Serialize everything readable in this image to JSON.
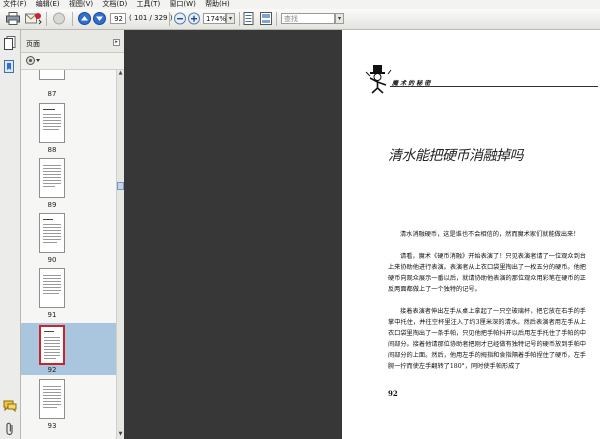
{
  "menu": [
    "文件(F)",
    "编辑(E)",
    "视图(V)",
    "文档(D)",
    "工具(T)",
    "窗口(W)",
    "帮助(H)"
  ],
  "toolbar": {
    "page_number": "92",
    "page_count": "( 101 / 329 )",
    "zoom": "174%",
    "search_placeholder": "查找"
  },
  "panel": {
    "title": "页面",
    "thumbnails": [
      {
        "label": "87"
      },
      {
        "label": "88"
      },
      {
        "label": "89"
      },
      {
        "label": "90"
      },
      {
        "label": "91"
      },
      {
        "label": "92",
        "selected": true
      },
      {
        "label": "93"
      }
    ]
  },
  "page": {
    "header": "魔 术 的 秘 密",
    "title": "清水能把硬币消融掉吗",
    "paragraphs": [
      "清水消融硬币，这是谁也不会相信的，然而魔术家们就能做出来！",
      "请看，魔术《硬币消融》开始表演了！只见表演者请了一位观众到台上来协助他进行表演。表演者从上衣口袋里掏出了一枚五分的硬币。他把硬币向观众展示一番以后，就请协助他表演的那位观众用彩笔在硬币的正反两面都做上了一个独特的记号。",
      "接着表演者伸出左手从桌上拿起了一只空玻璃杯，把它放在右手的手掌中托住，并往空杯里注入了约3厘米深的清水。然后表演者用左手从上衣口袋里掏出了一条手帕，只见他把手帕抖开以后用左手托住了手帕的中间部分。接着他请那位协助者把刚才已经做有独特记号的硬币放到手帕中间部分的上面。然后，他用左手的拇指和食指隔着手帕捏住了硬币，左手腕一拧而使左手翻转了180°，同时使手帕形成了"
    ],
    "page_number": "92"
  }
}
